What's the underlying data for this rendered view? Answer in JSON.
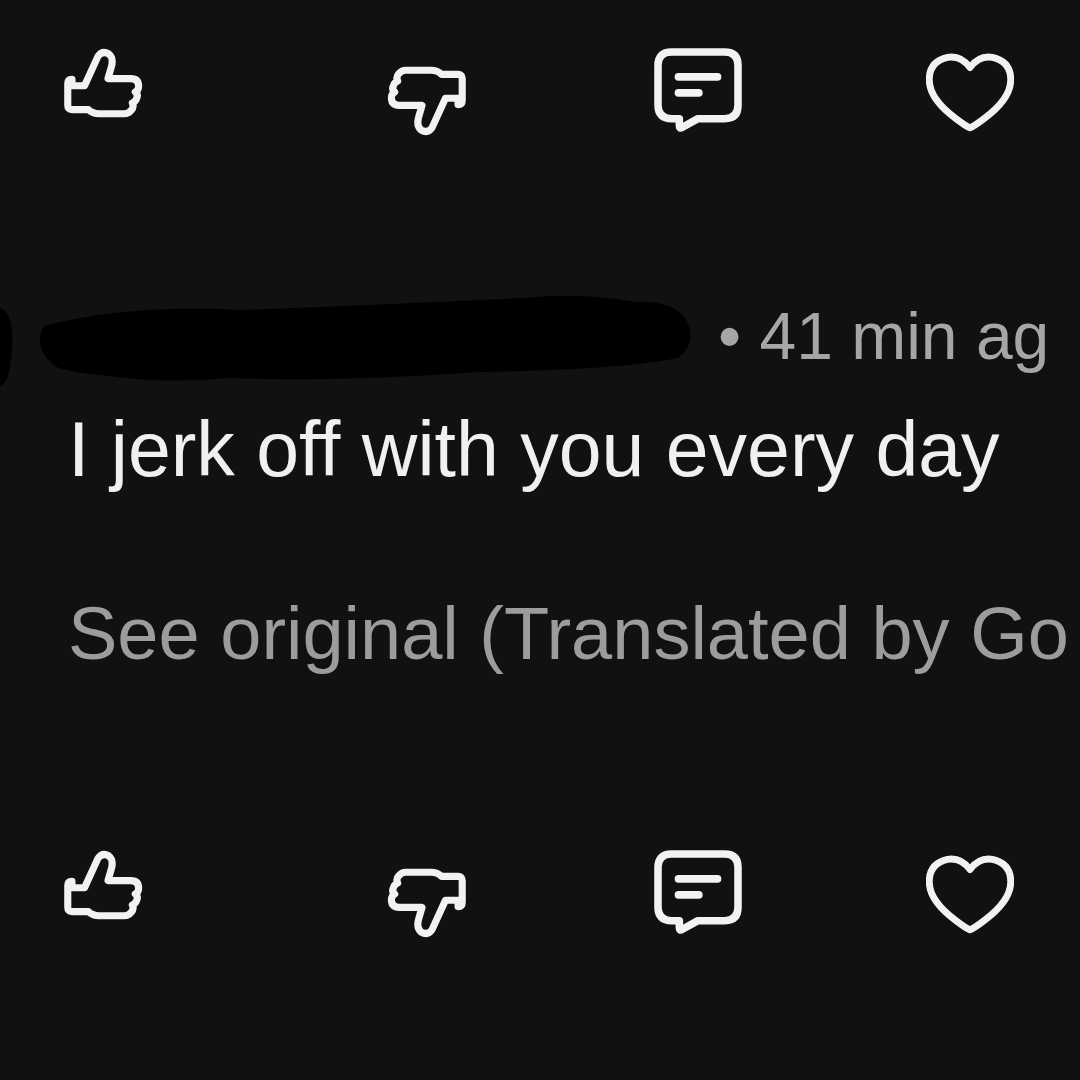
{
  "top_actions": [
    {
      "kind": "like"
    },
    {
      "kind": "dislike"
    },
    {
      "kind": "reply"
    },
    {
      "kind": "favorite"
    }
  ],
  "comment": {
    "author_redacted": true,
    "time": "• 41 min ag",
    "text": "I jerk off with you every day",
    "translation_link": "See original (Translated by Go"
  },
  "bottom_actions": [
    {
      "kind": "like"
    },
    {
      "kind": "dislike"
    },
    {
      "kind": "reply"
    },
    {
      "kind": "favorite"
    }
  ]
}
